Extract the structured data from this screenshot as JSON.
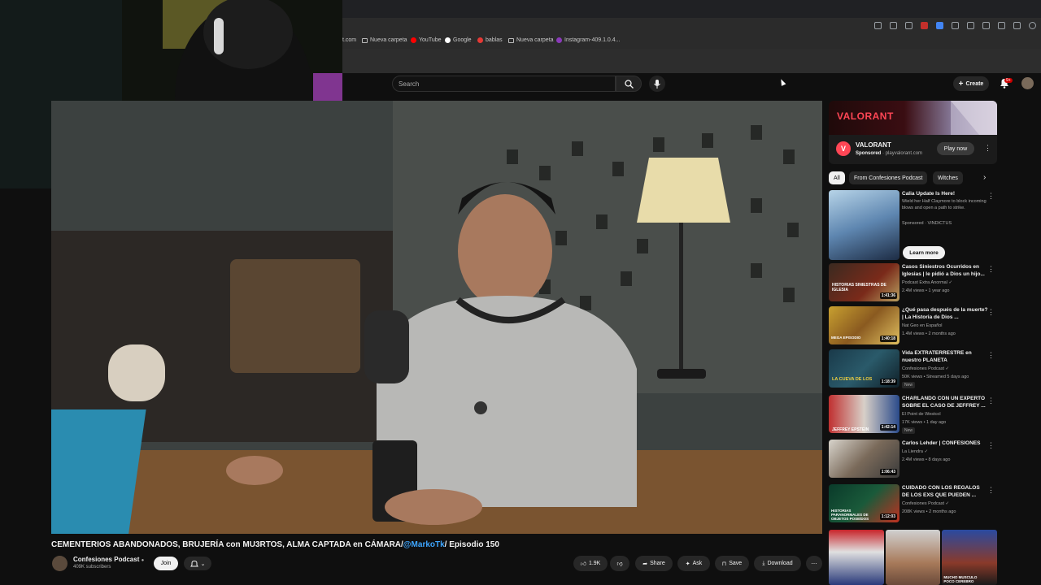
{
  "bookmarks": [
    {
      "label": "t.com",
      "type": "text"
    },
    {
      "label": "Nueva carpeta",
      "type": "folder"
    },
    {
      "label": "YouTube",
      "type": "youtube"
    },
    {
      "label": "Google",
      "type": "google"
    },
    {
      "label": "bablas",
      "type": "red"
    },
    {
      "label": "Nueva carpeta",
      "type": "folder"
    },
    {
      "label": "Instagram-409.1.0.4...",
      "type": "instagram"
    }
  ],
  "header": {
    "search_placeholder": "Search",
    "create_label": "Create",
    "notification_badge": "9+"
  },
  "video": {
    "title_part1": "CEMENTERIOS ABANDONADOS, BRUJERÍA con MU3RTOS, ALMA CAPTADA en CÁMARA/",
    "title_link": "@MarkoTk",
    "title_part2": "/ Episodio 150",
    "channel_name": "Confesiones Podcast",
    "subscribers": "409K subscribers",
    "join_label": "Join",
    "like_count": "1.9K",
    "share_label": "Share",
    "ask_label": "Ask",
    "save_label": "Save",
    "download_label": "Download"
  },
  "ad": {
    "banner_logo": "VALORANT",
    "title": "VALORANT",
    "sponsored": "Sponsored",
    "domain": "playvalorant.com",
    "cta": "Play now"
  },
  "chips": [
    "All",
    "From Confesiones Podcast",
    "Witches"
  ],
  "recommendations": [
    {
      "title": "Calia Update Is Here!",
      "channel": "Wield her Half Claymore to block incoming blows and open a path to strike.",
      "meta": "Sponsored · VINDICTUS",
      "duration": "",
      "new": "",
      "cta": "Learn more"
    },
    {
      "title": "Casos Siniestros Ocurridos en Iglesias | le pidió a Dios un hijo...",
      "channel": "Podcast Extra Anormal ✓",
      "meta": "2.4M views • 1 year ago",
      "duration": "1:41:36",
      "new": ""
    },
    {
      "title": "¿Qué pasa después de la muerte? | La Historia de Dios ...",
      "channel": "Nat Geo en Español",
      "meta": "1.4M views • 2 months ago",
      "duration": "1:40:18",
      "new": ""
    },
    {
      "title": "Vida EXTRATERRESTRE en nuestro PLANETA",
      "channel": "Confesiones Podcast ✓",
      "meta": "50K views • Streamed 5 days ago",
      "duration": "1:18:39",
      "new": "New"
    },
    {
      "title": "CHARLANDO CON UN EXPERTO SOBRE EL CASO DE JEFFREY ...",
      "channel": "El Point de Westcol",
      "meta": "17K views • 1 day ago",
      "duration": "1:42:14",
      "new": "New"
    },
    {
      "title": "Carlos Lehder | CONFESIONES",
      "channel": "La Liendra ✓",
      "meta": "2.4M views • 8 days ago",
      "duration": "1:06:43",
      "new": ""
    },
    {
      "title": "CUIDADO CON LOS REGALOS DE LOS EXS QUE PUEDEN ...",
      "channel": "Confesiones Podcast ✓",
      "meta": "208K views • 2 months ago",
      "duration": "1:12:03",
      "new": ""
    }
  ],
  "thumb_texts": {
    "r1": "HISTORIAS SINIESTRAS DE IGLESIA",
    "r2": "MEGA EPISODIO",
    "r3": "LA CUEVA DE LOS",
    "r4": "JEFFREY EPSTEIN",
    "r6": "HISTORIAS PARANORMALES DE OBJETOS POSEÍDOS",
    "bottom": "MUCHO MUSCULO POCO CEREBRO"
  },
  "colors": {
    "accent_red": "#ff0000",
    "link_blue": "#3ea6ff",
    "valorant_red": "#ff4655"
  }
}
